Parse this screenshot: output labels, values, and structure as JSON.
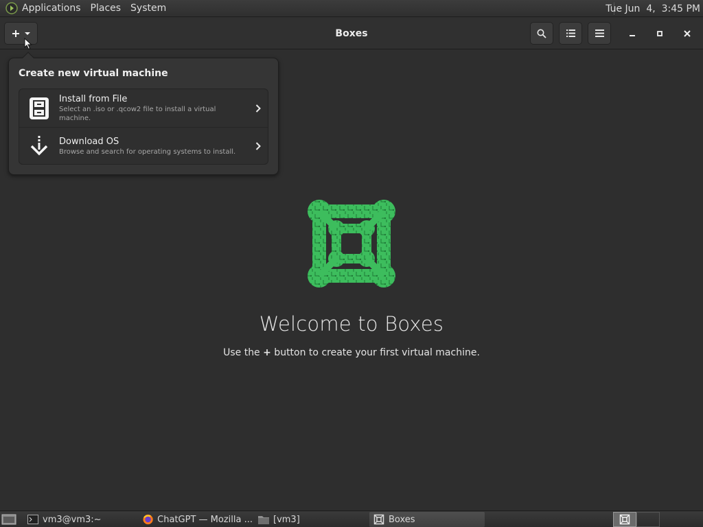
{
  "top_panel": {
    "menus": [
      "Applications",
      "Places",
      "System"
    ],
    "clock": "Tue Jun  4,  3:45 PM"
  },
  "header": {
    "title": "Boxes",
    "new_button_icon": "plus-icon",
    "dropdown_icon": "chevron-down-icon"
  },
  "popover": {
    "title": "Create new virtual machine",
    "items": [
      {
        "label": "Install from File",
        "description": "Select an .iso or .qcow2 file to install a virtual machine.",
        "icon": "file-cabinet-icon"
      },
      {
        "label": "Download OS",
        "description": "Browse and search for operating systems to install.",
        "icon": "download-icon"
      }
    ]
  },
  "welcome": {
    "title": "Welcome to Boxes",
    "subtitle_before": "Use the ",
    "subtitle_plus": "+",
    "subtitle_after": " button to create your first virtual machine."
  },
  "taskbar": {
    "tasks": [
      {
        "label": "vm3@vm3:~",
        "icon": "terminal-icon",
        "active": false
      },
      {
        "label": "ChatGPT — Mozilla ...",
        "icon": "firefox-icon",
        "active": false
      },
      {
        "label": "[vm3]",
        "icon": "folder-icon",
        "active": false
      },
      {
        "label": "Boxes",
        "icon": "boxes-icon",
        "active": true
      }
    ]
  },
  "colors": {
    "background": "#2e2e2e",
    "logo_green": "#3dbd5d",
    "logo_dark_green": "#1f7a37"
  }
}
